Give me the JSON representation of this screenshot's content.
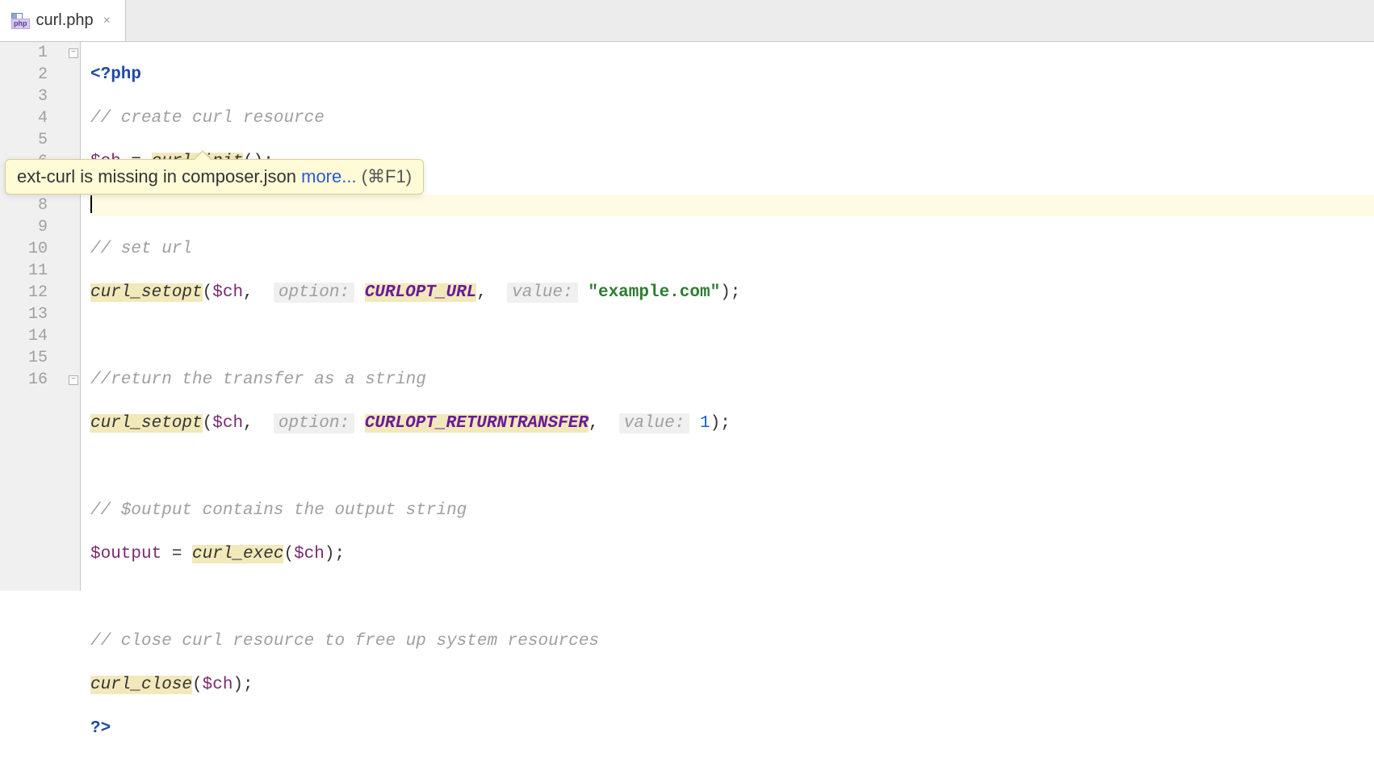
{
  "tab": {
    "filename": "curl.php",
    "fileTypeBadge": "php"
  },
  "tooltip": {
    "message": "ext-curl is missing in composer.json ",
    "moreLabel": "more...",
    "shortcut": " (⌘F1)"
  },
  "gutter": {
    "start": 1,
    "end": 16
  },
  "code": {
    "l1_open": "<?php",
    "l2_comment": "// create curl resource",
    "l3_var": "$ch",
    "l3_eq": " = ",
    "l3_fn": "curl_init",
    "l3_rest": "();",
    "l5_comment": "// set url",
    "l6_fn": "curl_setopt",
    "l6_p1": "(",
    "l6_var": "$ch",
    "l6_c1": ",  ",
    "l6_hint1_label": "option:",
    "l6_sp1": " ",
    "l6_const": "CURLOPT_URL",
    "l6_c2": ",  ",
    "l6_hint2_label": "value:",
    "l6_sp2": " ",
    "l6_str": "\"example.com\"",
    "l6_end": ");",
    "l8_comment": "//return the transfer as a string",
    "l9_fn": "curl_setopt",
    "l9_p1": "(",
    "l9_var": "$ch",
    "l9_c1": ",  ",
    "l9_hint1_label": "option:",
    "l9_sp1": " ",
    "l9_const": "CURLOPT_RETURNTRANSFER",
    "l9_c2": ",  ",
    "l9_hint2_label": "value:",
    "l9_sp2": " ",
    "l9_num": "1",
    "l9_end": ");",
    "l11_comment": "// $output contains the output string",
    "l12_var1": "$output",
    "l12_eq": " = ",
    "l12_fn": "curl_exec",
    "l12_p1": "(",
    "l12_var2": "$ch",
    "l12_end": ");",
    "l14_comment": "// close curl resource to free up system resources",
    "l15_fn": "curl_close",
    "l15_p1": "(",
    "l15_var": "$ch",
    "l15_end": ");",
    "l16_close": "?>"
  }
}
